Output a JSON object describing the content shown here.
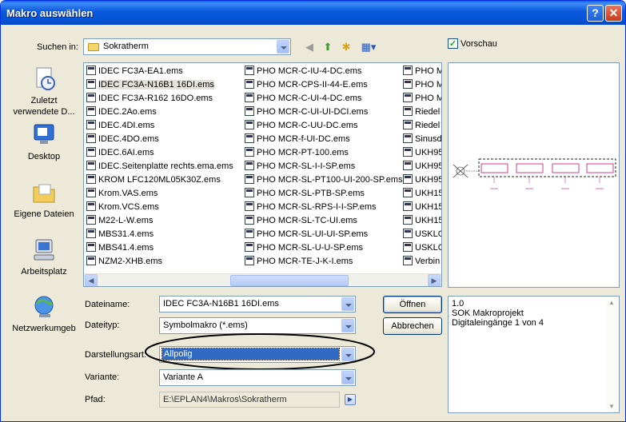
{
  "window": {
    "title": "Makro auswählen",
    "help_glyph": "?",
    "close_glyph": "✕"
  },
  "lookin": {
    "label": "Suchen in:",
    "value": "Sokratherm"
  },
  "preview_checkbox": {
    "label": "Vorschau",
    "checked": true
  },
  "places": [
    {
      "label1": "Zuletzt",
      "label2": "verwendete D...",
      "icon": "recent-documents-icon"
    },
    {
      "label1": "Desktop",
      "label2": "",
      "icon": "desktop-icon"
    },
    {
      "label1": "Eigene Dateien",
      "label2": "",
      "icon": "my-documents-icon"
    },
    {
      "label1": "Arbeitsplatz",
      "label2": "",
      "icon": "my-computer-icon"
    },
    {
      "label1": "Netzwerkumgeb",
      "label2": "",
      "icon": "network-icon"
    }
  ],
  "files": {
    "col1": [
      "IDEC FC3A-EA1.ems",
      "IDEC FC3A-N16B1 16DI.ems",
      "IDEC FC3A-R162 16DO.ems",
      "IDEC.2Ao.ems",
      "IDEC.4DI.ems",
      "IDEC.4DO.ems",
      "IDEC.6AI.ems",
      "IDEC.Seitenplatte rechts.ema.ems",
      "KROM LFC120ML05K30Z.ems",
      "Krom.VAS.ems",
      "Krom.VCS.ems",
      "M22-L-W.ems",
      "MBS31.4.ems",
      "MBS41.4.ems",
      "NZM2-XHB.ems"
    ],
    "col2": [
      "PHO MCR-C-IU-4-DC.ems",
      "PHO MCR-CPS-II-44-E.ems",
      "PHO MCR-C-UI-4-DC.ems",
      "PHO MCR-C-UI-UI-DCI.ems",
      "PHO MCR-C-UU-DC.ems",
      "PHO MCR-f-UI-DC.ems",
      "PHO MCR-PT-100.ems",
      "PHO MCR-SL-I-I-SP.ems",
      "PHO MCR-SL-PT100-UI-200-SP.ems",
      "PHO MCR-SL-PTB-SP.ems",
      "PHO MCR-SL-RPS-I-I-SP.ems",
      "PHO MCR-SL-TC-UI.ems",
      "PHO MCR-SL-UI-UI-SP.ems",
      "PHO MCR-SL-U-U-SP.ems",
      "PHO MCR-TE-J-K-I.ems"
    ],
    "col3": [
      "PHO M",
      "PHO M",
      "PHO M",
      "Riedel",
      "Riedel",
      "Sinusd",
      "UKH95",
      "UKH95",
      "UKH95",
      "UKH15",
      "UKH15",
      "UKH15",
      "USKLG",
      "USKLG",
      "Verbin"
    ],
    "selected": "IDEC FC3A-N16B1 16DI.ems"
  },
  "form": {
    "filename": {
      "label": "Dateiname:",
      "value": "IDEC FC3A-N16B1 16DI.ems"
    },
    "filetype": {
      "label": "Dateityp:",
      "value": "Symbolmakro (*.ems)"
    },
    "repr": {
      "label": "Darstellungsart:",
      "value": "Allpolig"
    },
    "variant": {
      "label": "Variante:",
      "value": "Variante A"
    },
    "path": {
      "label": "Pfad:",
      "value": "E:\\EPLAN4\\Makros\\Sokratherm"
    }
  },
  "buttons": {
    "open": "Öffnen",
    "cancel": "Abbrechen"
  },
  "info": {
    "line1": "1.0",
    "line2": "SOK Makroprojekt",
    "line3": "Digitaleingänge 1 von 4"
  },
  "colors": {
    "titlebar": "#0a58dc",
    "face": "#ece9d8",
    "border": "#7f9db9",
    "selection": "#316ac5"
  }
}
